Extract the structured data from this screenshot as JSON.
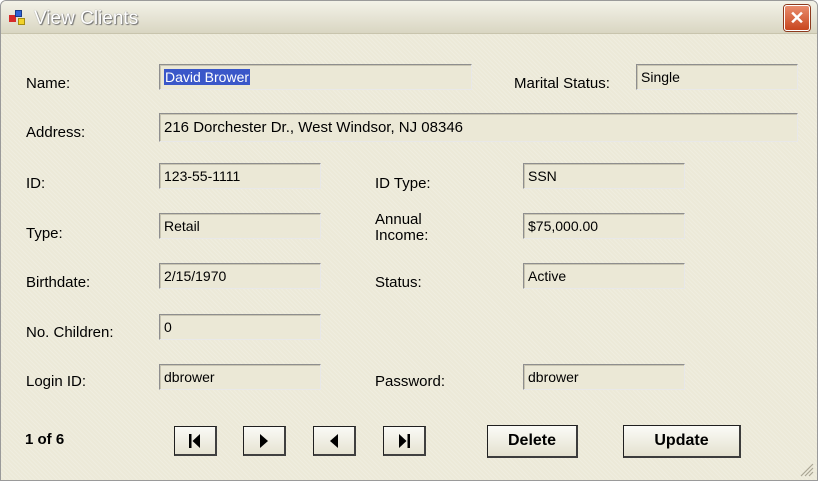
{
  "window": {
    "title": "View Clients",
    "close_glyph": "✕"
  },
  "icons": {
    "app": "app-window-icon",
    "close": "close-icon",
    "resize": "resize-grip-icon"
  },
  "labels": {
    "name": "Name:",
    "marital_status": "Marital Status:",
    "address": "Address:",
    "id": "ID:",
    "id_type": "ID Type:",
    "type": "Type:",
    "annual_income": "Annual\nIncome:",
    "birthdate": "Birthdate:",
    "status": "Status:",
    "no_children": "No. Children:",
    "login_id": "Login ID:",
    "password": "Password:"
  },
  "fields": {
    "name": "David Brower",
    "marital_status": "Single",
    "address": "216 Dorchester Dr., West Windsor, NJ 08346",
    "id": "123-55-1111",
    "id_type": "SSN",
    "type": "Retail",
    "annual_income": "$75,000.00",
    "birthdate": "2/15/1970",
    "status": "Active",
    "no_children": "0",
    "login_id": "dbrower",
    "password": "dbrower"
  },
  "navigation": {
    "record_count": "1 of 6",
    "first_icon": "first-record-icon",
    "next_icon": "next-record-icon",
    "prev_icon": "previous-record-icon",
    "last_icon": "last-record-icon"
  },
  "actions": {
    "delete": "Delete",
    "update": "Update"
  },
  "colors": {
    "window_bg": "#ece9d8",
    "selection": "#3a57c9",
    "close_button": "#c8461f"
  }
}
